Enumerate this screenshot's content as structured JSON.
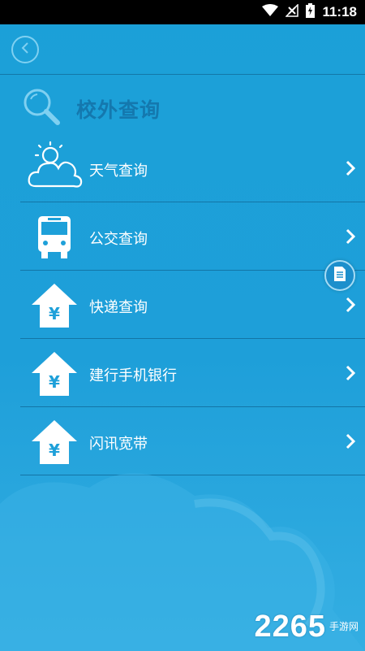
{
  "status": {
    "time": "11:18"
  },
  "header": {
    "section_title": "校外查询"
  },
  "menu": [
    {
      "label": "天气查询"
    },
    {
      "label": "公交查询"
    },
    {
      "label": "快递查询"
    },
    {
      "label": "建行手机银行"
    },
    {
      "label": "闪讯宽带"
    }
  ],
  "watermark": {
    "number": "2265",
    "suffix": "手游网"
  },
  "colors": {
    "background": "#1ea0d9",
    "title": "#1478ae",
    "divider": "#1375a6"
  },
  "icons": [
    "wifi-icon",
    "signal-icon",
    "battery-icon",
    "back-icon",
    "search-icon",
    "weather-icon",
    "bus-icon",
    "house-yen-icon",
    "chevron-right-icon",
    "document-icon"
  ]
}
